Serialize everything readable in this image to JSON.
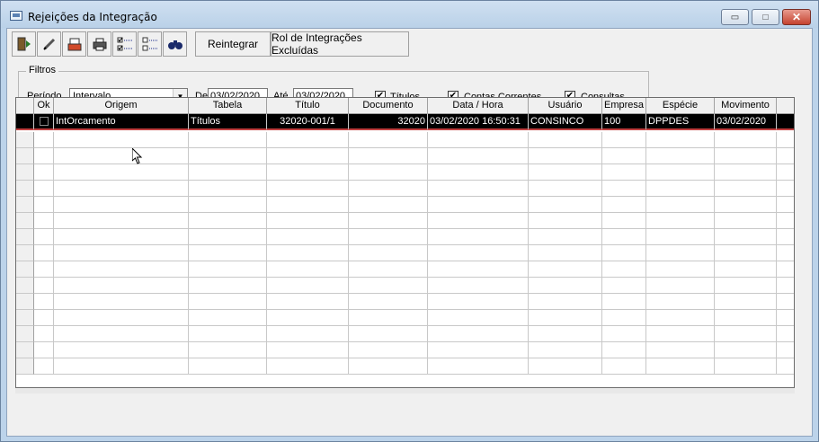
{
  "window": {
    "title": "Rejeições da Integração",
    "min_glyph": "▭",
    "max_glyph": "□",
    "close_glyph": "✕"
  },
  "toolbar": {
    "buttons": [
      "exit-icon",
      "edit-icon",
      "save-icon",
      "print-icon",
      "check-all-icon",
      "uncheck-all-icon",
      "binoculars-icon"
    ],
    "reintegrar_label": "Reintegrar",
    "excluded_label": "Rol de Integrações Excluídas"
  },
  "filters": {
    "legend": "Filtros",
    "periodo_label": "Período",
    "periodo_value": "Intervalo",
    "de_label": "De",
    "de_value": "03/02/2020",
    "ate_label": "Até",
    "ate_value": "03/02/2020",
    "titulos_label": "Títulos",
    "contas_label": "Contas Correntes",
    "consultas_label": "Consultas",
    "checked_glyph": "✔"
  },
  "grid": {
    "columns": [
      "Ok",
      "Origem",
      "Tabela",
      "Título",
      "Documento",
      "Data / Hora",
      "Usuário",
      "Empresa",
      "Espécie",
      "Movimento"
    ],
    "rows": [
      {
        "ok": "",
        "origem": "IntOrcamento",
        "tabela": "Títulos",
        "titulo": "32020-001/1",
        "documento": "32020",
        "data_hora": "03/02/2020 16:50:31",
        "usuario": "CONSINCO",
        "empresa": "100",
        "especie": "DPPDES",
        "movimento": "03/02/2020"
      }
    ]
  },
  "colors": {
    "selected_row_bg": "#000000",
    "selected_row_fg": "#ffffff",
    "title_bar": "#bcd3ea"
  }
}
